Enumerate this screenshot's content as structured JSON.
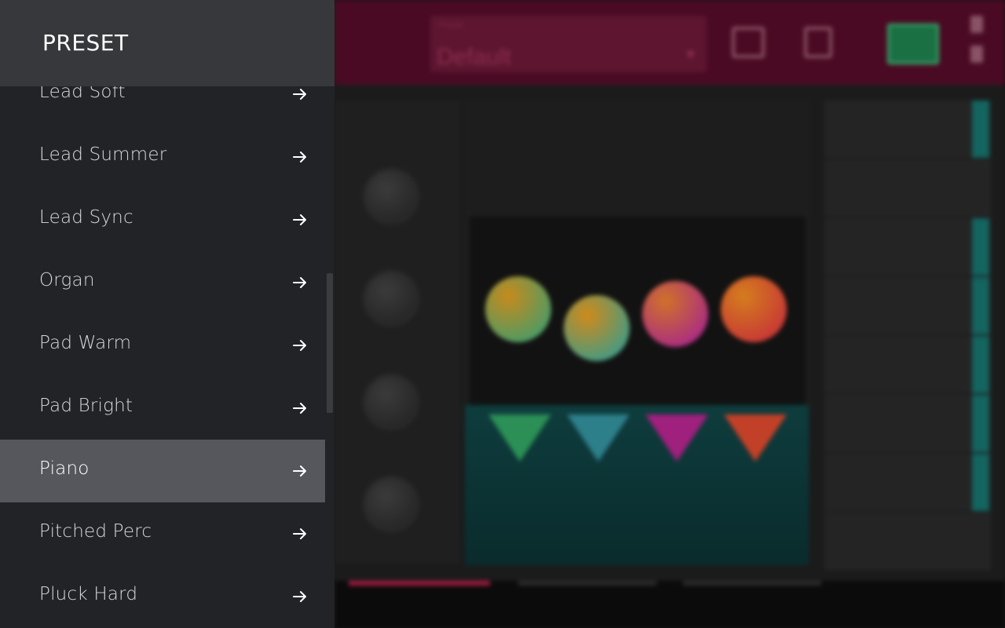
{
  "drawer": {
    "title": "PRESET",
    "items": [
      {
        "label": "Lead Soft",
        "selected": false
      },
      {
        "label": "Lead Summer",
        "selected": false
      },
      {
        "label": "Lead Sync",
        "selected": false
      },
      {
        "label": "Organ",
        "selected": false
      },
      {
        "label": "Pad Warm",
        "selected": false
      },
      {
        "label": "Pad Bright",
        "selected": false
      },
      {
        "label": "Piano",
        "selected": true
      },
      {
        "label": "Pitched Perc",
        "selected": false
      },
      {
        "label": "Pluck Hard",
        "selected": false
      }
    ],
    "arrow_icon": "arrow-right-icon",
    "colors": {
      "panel": "#222326",
      "header": "#37383c",
      "selected_row": "#55575c",
      "text": "#d8d9dc"
    }
  },
  "background": {
    "header": {
      "preset_label": "Preset",
      "preset_value": "Default"
    },
    "colors": {
      "header": "#4a0a23",
      "accent_teal": "#14645f"
    }
  }
}
